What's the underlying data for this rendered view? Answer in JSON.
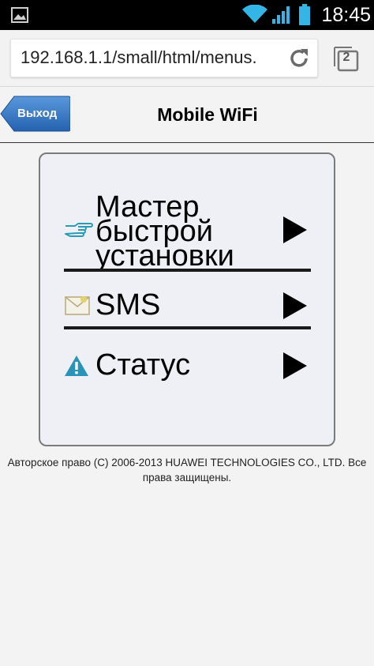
{
  "status_bar": {
    "time": "18:45"
  },
  "browser": {
    "url": "192.168.1.1/small/html/menus.",
    "tab_count": "2"
  },
  "header": {
    "back_label": "Выход",
    "title": "Mobile WiFi"
  },
  "menu": {
    "items": [
      {
        "label_lines": [
          "Мастер",
          "быстрой",
          "установки"
        ],
        "icon": "pointing-hand-icon"
      },
      {
        "label": "SMS",
        "icon": "envelope-icon"
      },
      {
        "label": "Статус",
        "icon": "warning-icon"
      }
    ]
  },
  "footer": {
    "copyright_line1": "Авторское право (C) 2006-2013 HUAWEI TECHNOLOGIES CO., LTD. Все",
    "copyright_line2": "права защищены."
  },
  "colors": {
    "back_button": "#2d6fc0",
    "status_bar": "#000000",
    "accent_blue": "#33b5e5",
    "warning": "#2a93b8"
  }
}
